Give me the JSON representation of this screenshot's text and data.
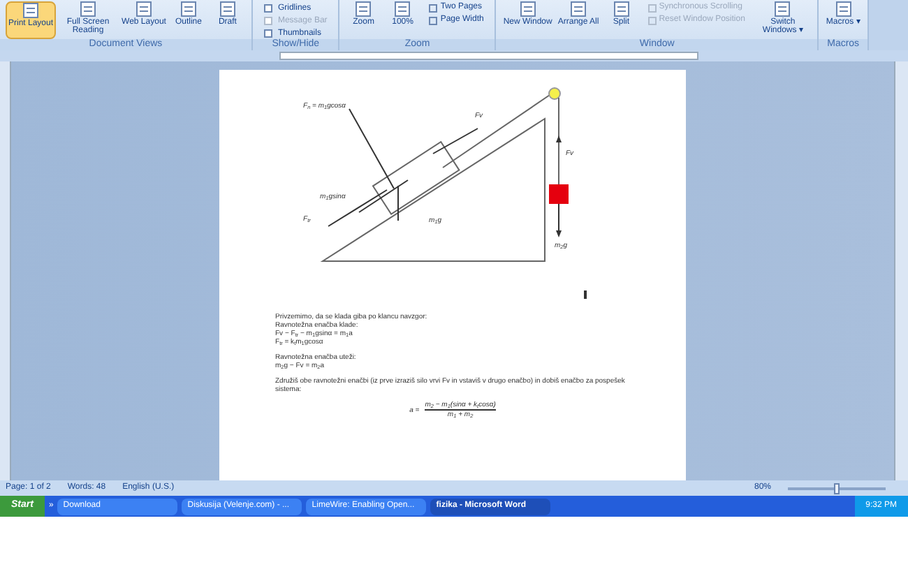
{
  "ribbon": {
    "groups": [
      {
        "label": "Document Views",
        "items": [
          {
            "label": "Print Layout",
            "kind": "big",
            "selected": true
          },
          {
            "label": "Full Screen Reading",
            "kind": "big",
            "selected": false
          },
          {
            "label": "Web Layout",
            "kind": "big",
            "selected": false
          },
          {
            "label": "Outline",
            "kind": "big",
            "selected": false
          },
          {
            "label": "Draft",
            "kind": "big",
            "selected": false
          }
        ]
      },
      {
        "label": "Show/Hide",
        "items": [
          {
            "label": "Gridlines",
            "kind": "check",
            "checked": false,
            "disabled": false
          },
          {
            "label": "Message Bar",
            "kind": "check",
            "checked": false,
            "disabled": true
          },
          {
            "label": "Thumbnails",
            "kind": "check",
            "checked": false,
            "disabled": false
          }
        ]
      },
      {
        "label": "Zoom",
        "items": [
          {
            "label": "Zoom",
            "kind": "big",
            "selected": false
          },
          {
            "label": "100%",
            "kind": "big",
            "selected": false
          },
          {
            "label": "Two Pages",
            "kind": "small",
            "disabled": false
          },
          {
            "label": "Page Width",
            "kind": "small",
            "disabled": false
          }
        ]
      },
      {
        "label": "Window",
        "items": [
          {
            "label": "New Window",
            "kind": "big",
            "selected": false
          },
          {
            "label": "Arrange All",
            "kind": "big",
            "selected": false
          },
          {
            "label": "Split",
            "kind": "big",
            "selected": false
          },
          {
            "label": "Synchronous Scrolling",
            "kind": "small",
            "disabled": true
          },
          {
            "label": "Reset Window Position",
            "kind": "small",
            "disabled": true
          },
          {
            "label": "Switch Windows ▾",
            "kind": "big",
            "selected": false
          }
        ]
      },
      {
        "label": "Macros",
        "items": [
          {
            "label": "Macros ▾",
            "kind": "big",
            "selected": false
          }
        ]
      }
    ]
  },
  "diagram": {
    "labels": [
      "F$_{n}$ = m$_{1}$gcosα",
      "Fv",
      "Fv",
      "m$_{1}$gsinα",
      "F$_{tr}$",
      "m$_{1}$g",
      "m$_{2}$g"
    ]
  },
  "document": {
    "paragraphs": [
      {
        "kind": "text",
        "lines": [
          "Privzemimo, da se klada giba po klancu navzgor:",
          "Ravnotežna enačba klade:",
          "Fv − F$_{tr}$ − m$_{1}$gsinα = m$_{1}$a",
          "F$_{tr}$ = k$_{t}$m$_{1}$gcosα"
        ]
      },
      {
        "kind": "text",
        "lines": [
          "Ravnotežna enačba uteži:",
          "m$_{2}$g − Fv = m$_{2}$a"
        ]
      },
      {
        "kind": "text",
        "lines": [
          "Združiš obe ravnotežni enačbi (iz prve izraziš silo vrvi Fv in vstaviš v drugo enačbo) in dobiš enačbo za pospešek sistema:"
        ]
      },
      {
        "kind": "fraction",
        "lhs": "a =",
        "numerator": "m$_{2}$ − m$_{1}$(sinα + k$_{t}$cosα)",
        "denominator": "m$_{1}$ + m$_{2}$"
      }
    ]
  },
  "status_bar": {
    "page": "Page: 1 of 2",
    "words": "Words: 48",
    "language": "English (U.S.)",
    "zoom": "80%",
    "level": 0.5
  },
  "taskbar": {
    "start": "Start",
    "overflow": "»",
    "tasks": [
      {
        "label": "Download",
        "selected": false
      },
      {
        "label": "Diskusija (Velenje.com) - ...",
        "selected": false
      },
      {
        "label": "LimeWire: Enabling Open...",
        "selected": false
      },
      {
        "label": "fizika - Microsoft Word",
        "selected": true
      }
    ],
    "time": "9:32 PM"
  }
}
